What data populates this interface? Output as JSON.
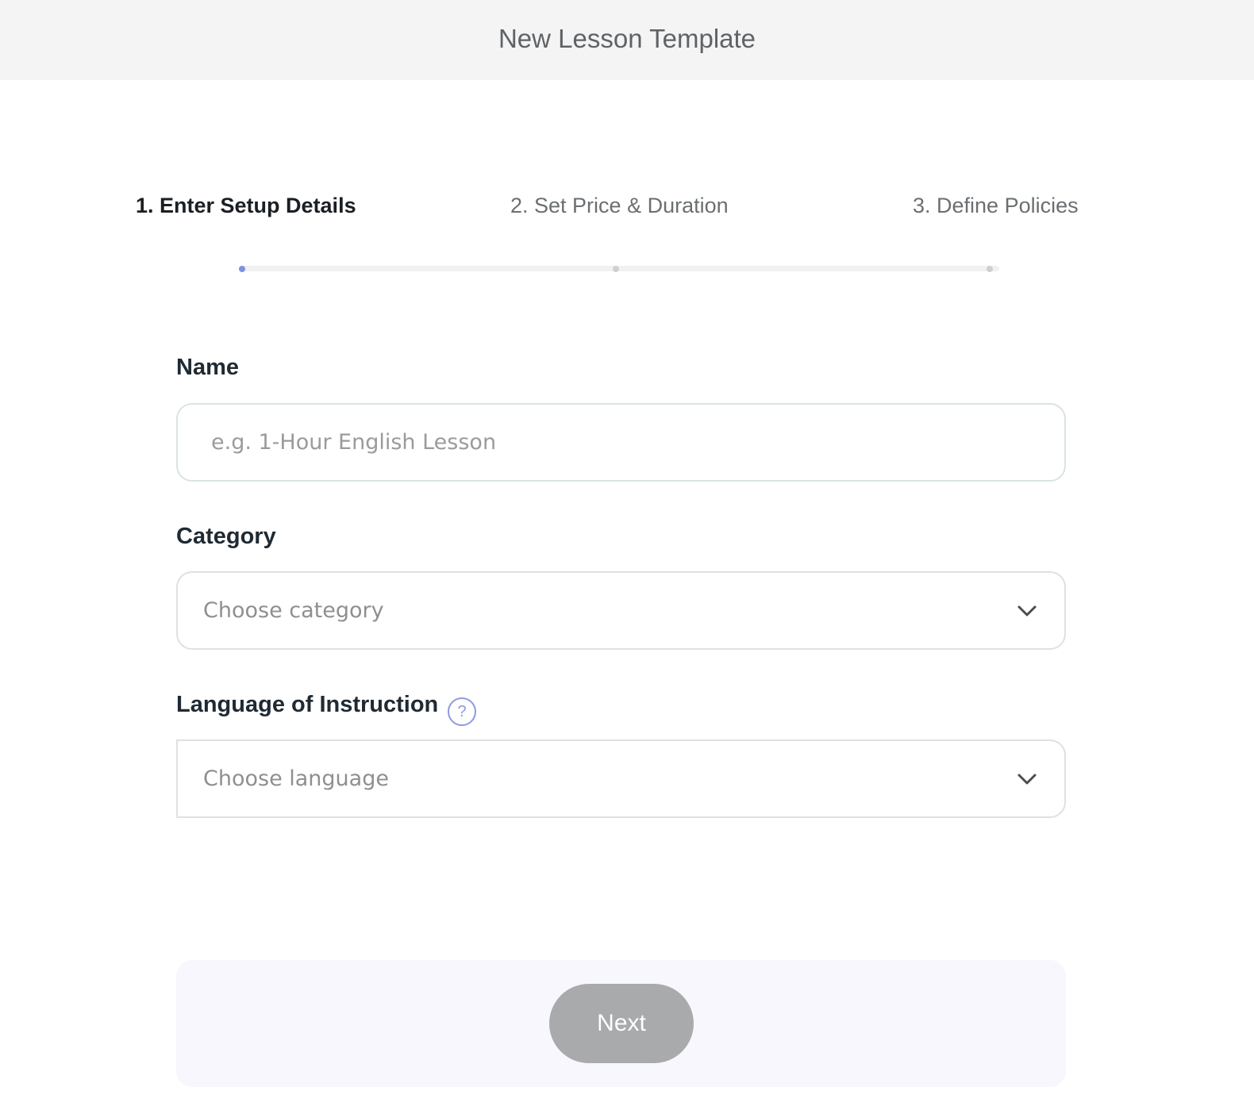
{
  "header": {
    "title": "New Lesson Template"
  },
  "steps": [
    {
      "label": "1. Enter Setup Details",
      "active": true
    },
    {
      "label": "2. Set Price & Duration",
      "active": false
    },
    {
      "label": "3. Define Policies",
      "active": false
    }
  ],
  "progress": {
    "current_step": 1,
    "total_steps": 3,
    "fraction_complete": 0
  },
  "form": {
    "name": {
      "label": "Name",
      "placeholder": "e.g. 1-Hour English Lesson",
      "value": ""
    },
    "category": {
      "label": "Category",
      "placeholder": "Choose category",
      "icon": "chevron-down-icon"
    },
    "language": {
      "label": "Language of Instruction",
      "placeholder": "Choose language",
      "help_icon": "question-mark-icon",
      "help_text": "?",
      "icon": "chevron-down-icon"
    }
  },
  "footer": {
    "next_label": "Next"
  },
  "colors": {
    "header_bg": "#f4f4f4",
    "accent": "#8d9ae0",
    "next_disabled": "#a9aaab",
    "footer_bg": "#f8f7fd"
  }
}
